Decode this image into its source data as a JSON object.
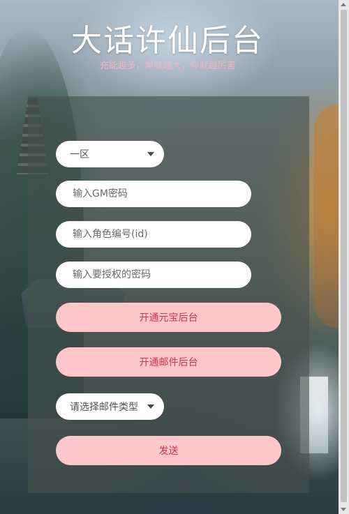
{
  "header": {
    "title": "大话许仙后台",
    "subtitle": "充能越多，屌就越大，你就越厉害"
  },
  "form": {
    "server_select": {
      "value": "一区"
    },
    "gm_password": {
      "placeholder": "输入GM密码",
      "value": ""
    },
    "role_id": {
      "placeholder": "输入角色编号(id)",
      "value": ""
    },
    "grant_password": {
      "placeholder": "输入要授权的密码",
      "value": ""
    },
    "open_yuanbao_label": "开通元宝后台",
    "open_mail_label": "开通邮件后台",
    "mail_type_select": {
      "value": "请选择邮件类型"
    },
    "send_label": "发送"
  },
  "colors": {
    "title": "#ffffff",
    "subtitle": "#f2b4c4",
    "button_bg": "#ffc7c9",
    "button_text": "#d2344b",
    "panel_bg": "rgba(70,80,78,0.62)"
  },
  "icons": {
    "select_arrow": "chevron-down-icon"
  }
}
